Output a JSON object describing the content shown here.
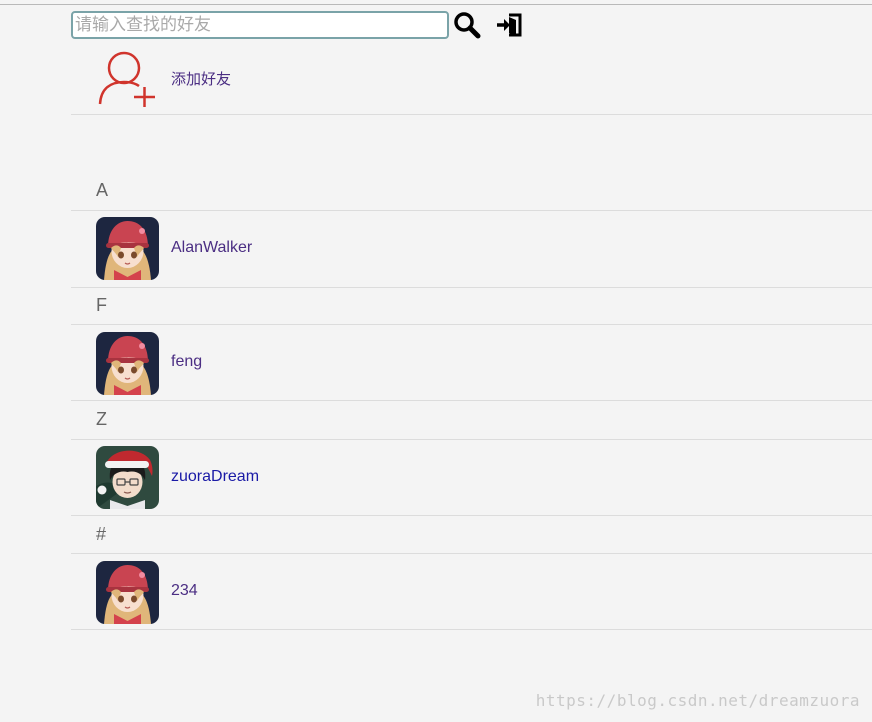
{
  "search": {
    "placeholder": "请输入查找的好友",
    "value": ""
  },
  "add_friend": {
    "label": "添加好友",
    "icon": "add-user-icon",
    "color": "#d0342c"
  },
  "groups": [
    {
      "letter": "A",
      "friends": [
        {
          "name": "AlanWalker",
          "avatar": "umaru-avatar"
        }
      ]
    },
    {
      "letter": "F",
      "friends": [
        {
          "name": "feng",
          "avatar": "umaru-avatar"
        }
      ]
    },
    {
      "letter": "Z",
      "friends": [
        {
          "name": "zuoraDream",
          "avatar": "santa-boy-avatar"
        }
      ]
    },
    {
      "letter": "#",
      "friends": [
        {
          "name": "234",
          "avatar": "umaru-avatar"
        }
      ]
    }
  ],
  "watermark": "https://blog.csdn.net/dreamzuora"
}
